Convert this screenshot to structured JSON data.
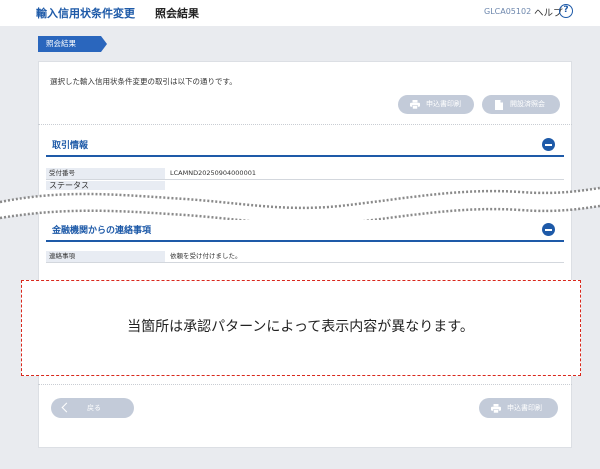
{
  "header": {
    "title": "輸入信用状条件変更",
    "subtitle": "照会結果",
    "screen_code": "GLCA05102",
    "help_label": "ヘルプ",
    "help_icon": "question-icon"
  },
  "step": {
    "label": "照会結果"
  },
  "description": "選択した輸入信用状条件変更の取引は以下の通りです。",
  "top_buttons": {
    "print_label": "申込書印刷",
    "opened_inquiry_label": "開設済照会"
  },
  "transaction_info": {
    "title": "取引情報",
    "rows": [
      {
        "label": "受付番号",
        "value": "LCAMND20250904000001"
      },
      {
        "label": "ステータス",
        "value": ""
      }
    ]
  },
  "bank_contact": {
    "title": "金融機関からの連絡事項",
    "rows": [
      {
        "label": "連絡事項",
        "value": "依頼を受け付けました。"
      }
    ]
  },
  "notice": "当箇所は承認パターンによって表示内容が異なります。",
  "bottom_buttons": {
    "back_label": "戻る",
    "print_label": "申込書印刷"
  },
  "colors": {
    "brand_blue": "#1e5aa8",
    "step_blue": "#2a66bd",
    "disabled_button": "#c3cbd9",
    "notice_border": "#d9281c"
  }
}
